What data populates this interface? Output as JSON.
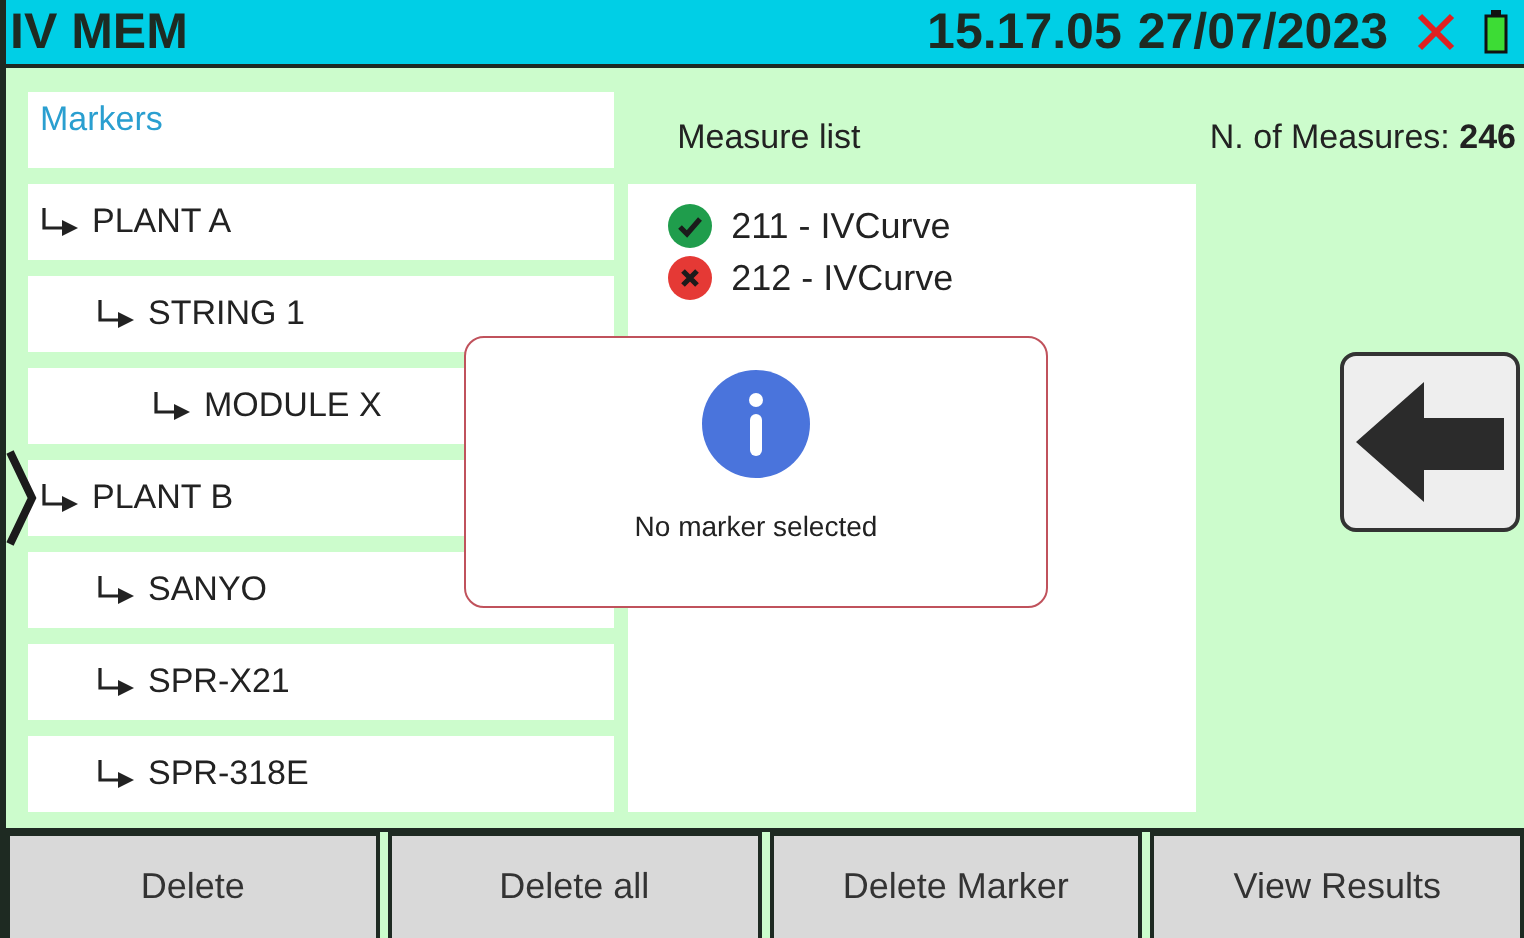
{
  "header": {
    "title": "IV MEM",
    "time": "15.17.05",
    "date": "27/07/2023"
  },
  "markers": {
    "title": "Markers",
    "items": [
      {
        "label": "PLANT A",
        "selected": false,
        "children": [
          {
            "label": "STRING 1",
            "selected": false,
            "children": [
              {
                "label": "MODULE X",
                "selected": false
              }
            ]
          }
        ]
      },
      {
        "label": "PLANT B",
        "selected": true,
        "children": [
          {
            "label": "SANYO",
            "selected": false
          },
          {
            "label": "SPR-X21",
            "selected": false
          },
          {
            "label": "SPR-318E",
            "selected": false
          }
        ]
      }
    ]
  },
  "measures": {
    "title": "Measure list",
    "count_label": "N. of Measures:",
    "count": "246",
    "items": [
      {
        "label": "211 - IVCurve",
        "kind": "ok"
      },
      {
        "label": "212 - IVCurve",
        "kind": "error"
      }
    ]
  },
  "dialog": {
    "message": "No marker selected"
  },
  "buttons": [
    "Delete",
    "Delete all",
    "Delete Marker",
    "View Results"
  ]
}
